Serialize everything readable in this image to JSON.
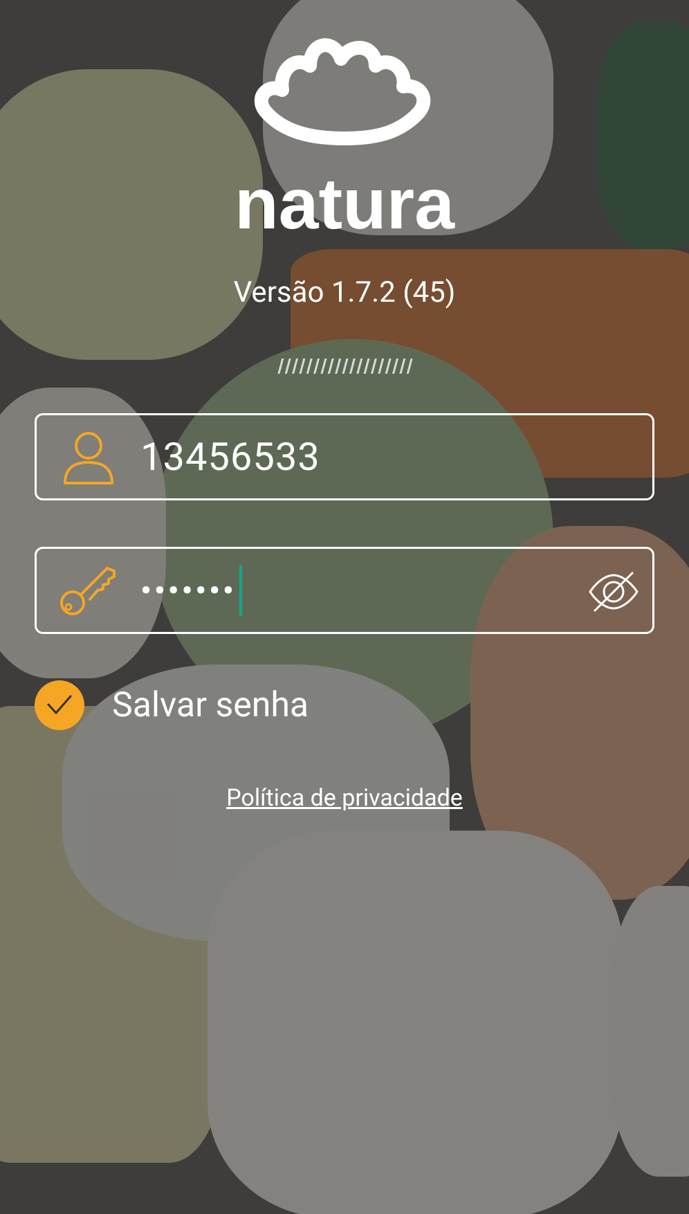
{
  "brand": {
    "name": "natura"
  },
  "version_label": "Versão 1.7.2 (45)",
  "login": {
    "user": {
      "icon": "user-icon",
      "value": "13456533"
    },
    "password": {
      "icon": "key-icon",
      "masked_value": "•••••••",
      "toggle_icon": "eye-off-icon"
    },
    "save_password": {
      "label": "Salvar senha",
      "checked": true,
      "icon": "check-icon"
    }
  },
  "privacy_link": "Política de privacidade",
  "colors": {
    "accent": "#f4a624",
    "caret": "#1aa38b",
    "text": "#ffffff"
  }
}
